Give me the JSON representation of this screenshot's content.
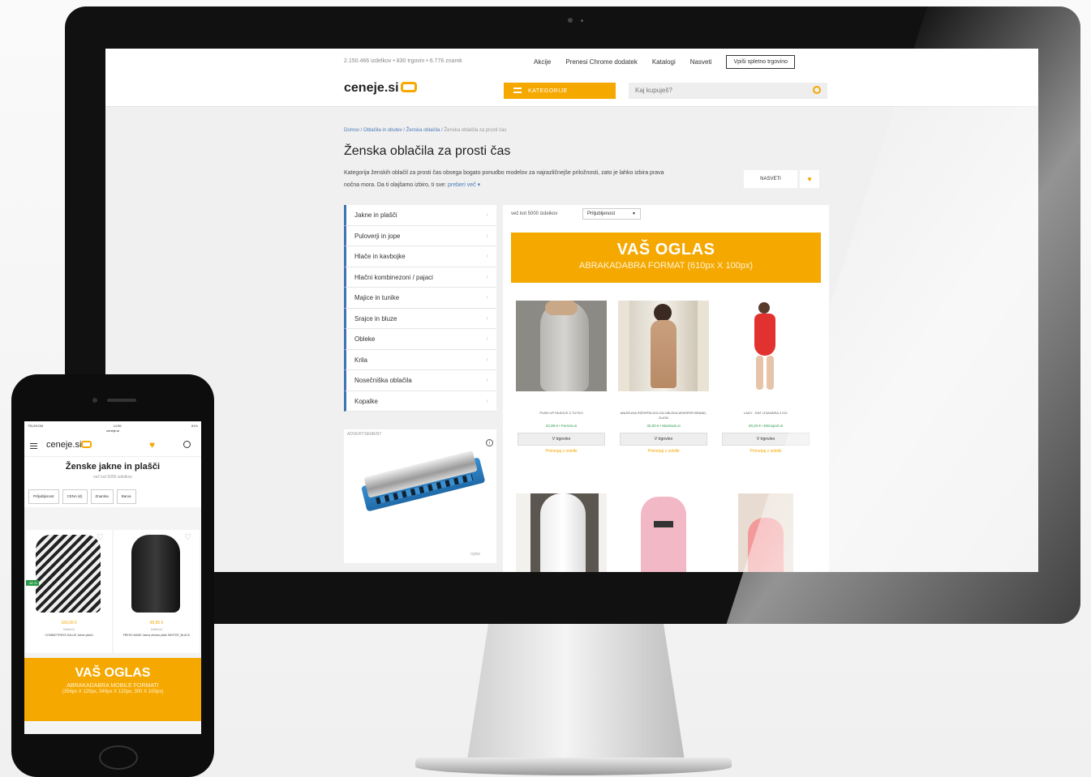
{
  "desktop": {
    "stats": "2.150.466 izdelkov • 830 trgovin • 6.776 znamk",
    "top_links": [
      "Akcije",
      "Prenesi Chrome dodatek",
      "Katalogi",
      "Nasveti"
    ],
    "top_button": "Vpiši spletno trgovino",
    "logo_text": "ceneje.si",
    "categories_button": "KATEGORIJE",
    "search_placeholder": "Kaj kupuješ?",
    "breadcrumbs": [
      "Domov",
      "Oblačila in obutev",
      "Ženska oblačila",
      "Ženska oblačila za prosti čas"
    ],
    "page_title": "Ženska oblačila za prosti čas",
    "description": "Kategorija ženskih oblačil za prosti čas obsega bogato ponudbo modelov za najrazličnejše priložnosti, zato je lahko izbira prava nočna mora. Da ti olajšamo izbiro, ti sve:",
    "read_more": "preberi več",
    "shop_button": "NASVETI",
    "sidebar_items": [
      "Jakne in plašči",
      "Puloverji in jope",
      "Hlače in kavbojke",
      "Hlačni kombinezoni / pajaci",
      "Majice in tunike",
      "Srajce in bluze",
      "Obleke",
      "Krila",
      "Nosečniška oblačila",
      "Kopalke"
    ],
    "ad_label": "ADVERTISEMENT",
    "ad_small": "oglas",
    "results_count": "več kot 5000 izdelkov",
    "sort_value": "Priljubljenost",
    "banner_title": "VAŠ OGLAS",
    "banner_subtitle": "ABRAKADABRA FORMAT (610px X 100px)",
    "products": [
      {
        "name": "PUSH UP PAJKICE Z TUTKO",
        "price": "22,99 € • Ferrera.si",
        "button": "V trgovino",
        "compare": "Primerjaj z izdelki"
      },
      {
        "name": "ANGELINA RIŽOPRA DOLGA OBLEKA WHISPER BRAND, ZLATA",
        "price": "40,00 € • Mamiwin.si",
        "button": "V trgovino",
        "compare": "Primerjaj z izdelki"
      },
      {
        "name": "LADY - ENT LISANDRA 4 021",
        "price": "29,20 € • Ekinsport.si",
        "button": "V trgovino",
        "compare": "Primerjaj z izdelki"
      }
    ]
  },
  "mobile": {
    "carrier": "TELEKOM",
    "time": "14:55",
    "battery": "81%",
    "url": "ceneje.si",
    "logo_text": "ceneje.si",
    "title": "Ženske jakne in plašči",
    "count": "več kot 5000 izdelkov",
    "filters": [
      "Priljubljenost",
      "CENA (€)",
      "Znamka",
      "Barva"
    ],
    "products": [
      {
        "sale": "-50 %",
        "price": "160,00 €",
        "store": "Kalibol.si",
        "name": "COMBATTRESS SALUE Jakne plašči"
      },
      {
        "price": "99,95 €",
        "store": "Kalibol.si",
        "name": "FRESH MADE Jakna zimska plašč WINTER_BLACK"
      }
    ],
    "banner_title": "VAŠ OGLAS",
    "banner_line1": "ABRAKADABRA MOBILE FORMATI",
    "banner_line2": "(356px X 120px, 340px X 120px, 300 X 100px)"
  },
  "colors": {
    "accent": "#f5a800",
    "link": "#4a7ab8",
    "price": "#2a9a4a"
  }
}
